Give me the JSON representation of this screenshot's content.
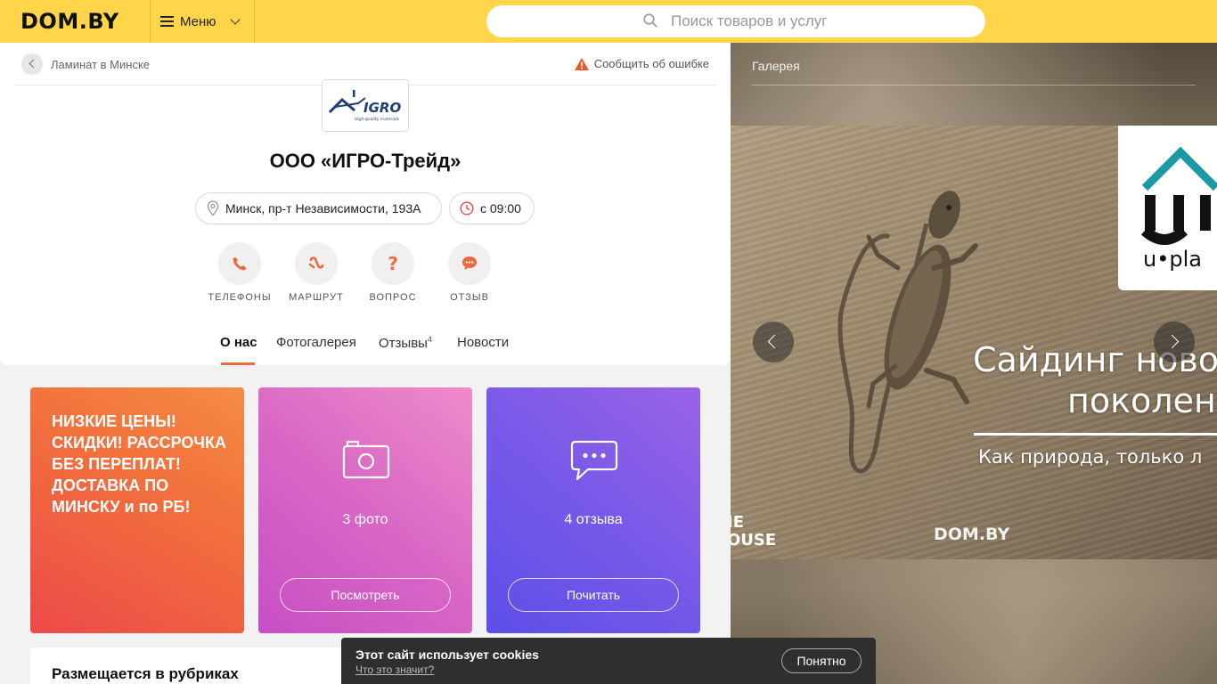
{
  "header": {
    "logo": "DOM.BY",
    "menu_label": "Меню",
    "search_placeholder": "Поиск товаров и услуг",
    "accent_color": "#ffd54a"
  },
  "company": {
    "breadcrumb": "Ламинат в Минске",
    "report_error": "Сообщить об ошибке",
    "logo_text": "IGRO",
    "logo_tagline": "High-quality materials",
    "name": "ООО «ИГРО-Трейд»",
    "address": "Минск, пр-т Независимости, 193А",
    "hours": "с 09:00",
    "actions": [
      {
        "label": "ТЕЛЕФОНЫ",
        "icon": "phone-icon"
      },
      {
        "label": "МАРШРУТ",
        "icon": "route-icon"
      },
      {
        "label": "ВОПРОС",
        "icon": "question-icon"
      },
      {
        "label": "ОТЗЫВ",
        "icon": "chat-icon"
      }
    ],
    "tabs": [
      {
        "label": "О нас",
        "active": true
      },
      {
        "label": "Фотогалерея"
      },
      {
        "label": "Отзывы",
        "badge": "4"
      },
      {
        "label": "Новости"
      }
    ],
    "accent_color": "#ee6a3d"
  },
  "tiles": {
    "promo_text": "НИЗКИЕ ЦЕНЫ! СКИДКИ! РАССРОЧКА БЕЗ ПЕРЕПЛАТ! ДОСТАВКА ПО МИНСКУ и по РБ!",
    "photo": {
      "caption": "3 фото",
      "button": "Посмотреть"
    },
    "reviews": {
      "caption": "4 отзыва",
      "button": "Почитать"
    }
  },
  "rubrics": {
    "title": "Размещается в рубриках"
  },
  "gallery": {
    "title": "Галерея",
    "slide": {
      "brand": "u•pla",
      "headline_1": "Сайдинг ново",
      "headline_2": "поколен",
      "subline": "Как природа, только л",
      "house_text_1": "IE",
      "house_text_2": "OUSE",
      "watermark": "DOM.BY"
    }
  },
  "cookie": {
    "title": "Этот сайт использует cookies",
    "link": "Что это значит?",
    "button": "Понятно"
  }
}
